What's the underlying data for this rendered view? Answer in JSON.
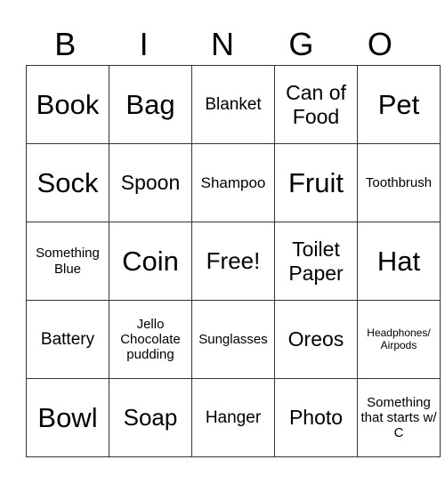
{
  "header": [
    "B",
    "I",
    "N",
    "G",
    "O"
  ],
  "rows": [
    [
      "Book",
      "Bag",
      "Blanket",
      "Can of Food",
      "Pet"
    ],
    [
      "Sock",
      "Spoon",
      "Shampoo",
      "Fruit",
      "Toothbrush"
    ],
    [
      "Something Blue",
      "Coin",
      "Free!",
      "Toilet Paper",
      "Hat"
    ],
    [
      "Battery",
      "Jello Chocolate pudding",
      "Sunglasses",
      "Oreos",
      "Headphones/ Airpods"
    ],
    [
      "Bowl",
      "Soap",
      "Hanger",
      "Photo",
      "Something that starts w/ C"
    ]
  ]
}
